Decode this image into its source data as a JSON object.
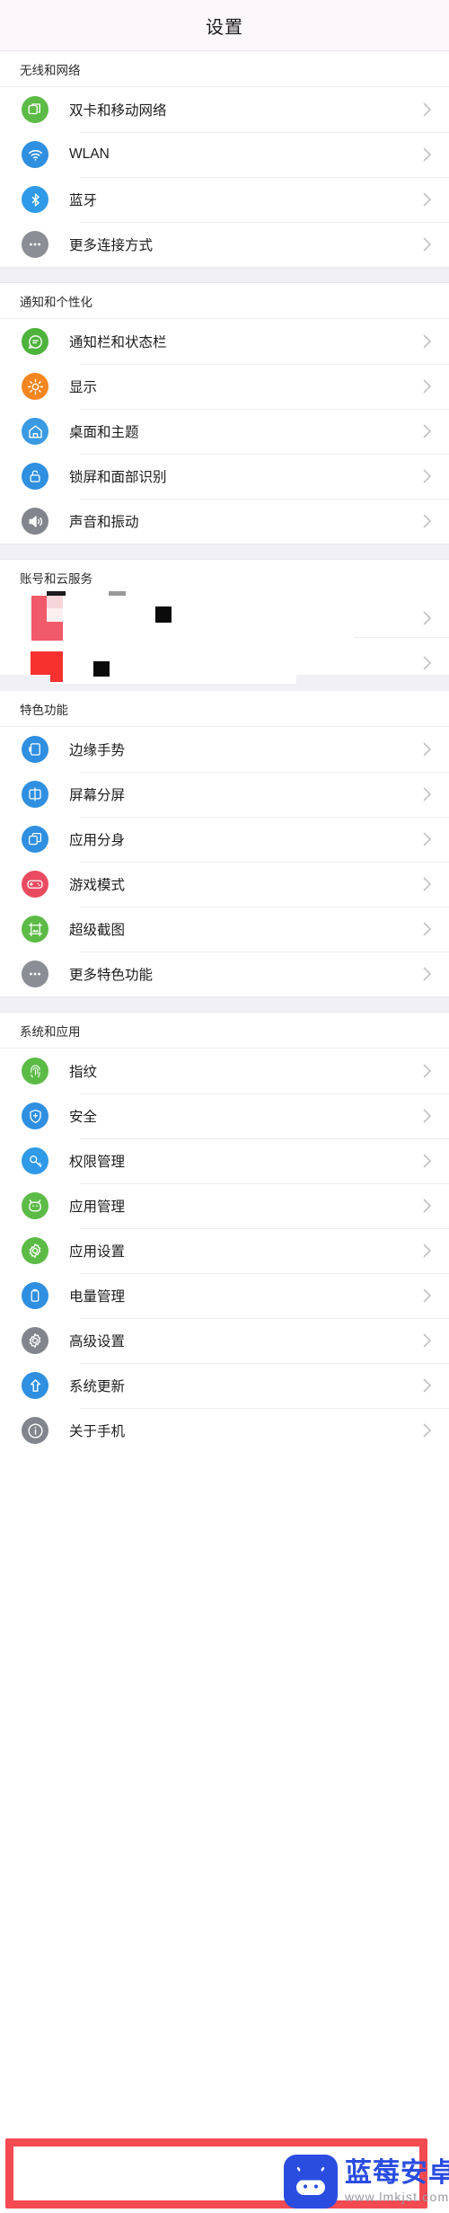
{
  "header": {
    "title": "设置"
  },
  "sections": [
    {
      "id": "wireless",
      "label": "无线和网络",
      "rows": [
        {
          "label": "双卡和移动网络",
          "icon": "sim-card-icon",
          "color": "#5cbb46"
        },
        {
          "label": "WLAN",
          "icon": "wifi-icon",
          "color": "#2f8fe0"
        },
        {
          "label": "蓝牙",
          "icon": "bluetooth-icon",
          "color": "#2f9ae8"
        },
        {
          "label": "更多连接方式",
          "icon": "more-dots-icon",
          "color": "#8b8f95"
        }
      ]
    },
    {
      "id": "notification",
      "label": "通知和个性化",
      "rows": [
        {
          "label": "通知栏和状态栏",
          "icon": "chat-bubble-icon",
          "color": "#4eb33c"
        },
        {
          "label": "显示",
          "icon": "brightness-icon",
          "color": "#f5861f"
        },
        {
          "label": "桌面和主题",
          "icon": "home-icon",
          "color": "#3a9ae3"
        },
        {
          "label": "锁屏和面部识别",
          "icon": "lock-icon",
          "color": "#2f8fe0"
        },
        {
          "label": "声音和振动",
          "icon": "speaker-icon",
          "color": "#82868c"
        }
      ]
    },
    {
      "id": "account",
      "label": "账号和云服务",
      "corrupted": true,
      "rows": [
        {
          "label": "",
          "icon": "corrupted-icon",
          "color": "#f05a6a"
        },
        {
          "label": "",
          "icon": "corrupted-icon",
          "color": "#f7322e"
        }
      ]
    },
    {
      "id": "features",
      "label": "特色功能",
      "rows": [
        {
          "label": "边缘手势",
          "icon": "edge-gesture-icon",
          "color": "#2f8fe0"
        },
        {
          "label": "屏幕分屏",
          "icon": "split-screen-icon",
          "color": "#2f8fe0"
        },
        {
          "label": "应用分身",
          "icon": "app-clone-icon",
          "color": "#2f8fe0"
        },
        {
          "label": "游戏模式",
          "icon": "gamepad-icon",
          "color": "#ea4b60"
        },
        {
          "label": "超级截图",
          "icon": "screenshot-icon",
          "color": "#5cbb46"
        },
        {
          "label": "更多特色功能",
          "icon": "more-dots-icon",
          "color": "#8b8f95"
        }
      ]
    },
    {
      "id": "system",
      "label": "系统和应用",
      "rows": [
        {
          "label": "指纹",
          "icon": "fingerprint-icon",
          "color": "#5cbb46"
        },
        {
          "label": "安全",
          "icon": "shield-plus-icon",
          "color": "#2f8fe0"
        },
        {
          "label": "权限管理",
          "icon": "permission-key-icon",
          "color": "#2f9ae8"
        },
        {
          "label": "应用管理",
          "icon": "app-manage-icon",
          "color": "#5cbb46"
        },
        {
          "label": "应用设置",
          "icon": "app-settings-gear-icon",
          "color": "#5cbb46"
        },
        {
          "label": "电量管理",
          "icon": "battery-icon",
          "color": "#2f8fe0"
        },
        {
          "label": "高级设置",
          "icon": "advanced-gear-icon",
          "color": "#82868c"
        },
        {
          "label": "系统更新",
          "icon": "system-update-icon",
          "color": "#2f8fe0"
        },
        {
          "label": "关于手机",
          "icon": "info-icon",
          "color": "#82868c",
          "highlighted": true
        }
      ]
    }
  ],
  "watermark": {
    "brand": "蓝莓安卓网",
    "url": "www.lmkjst.com",
    "logo": "android-robot-icon"
  },
  "colors": {
    "highlight": "#f44a52",
    "title_bar_bg": "#fbf7fb",
    "group_gap_bg": "#f0f0f5",
    "chevron": "#c2c2c2",
    "text": "#1d1d1d"
  }
}
